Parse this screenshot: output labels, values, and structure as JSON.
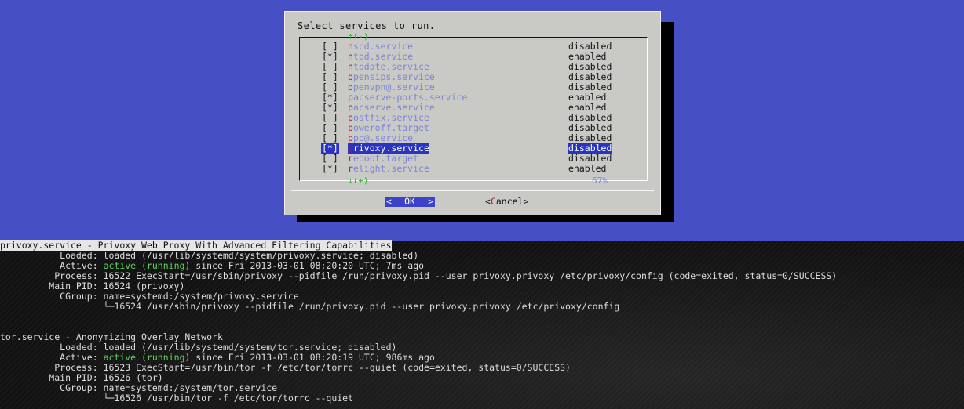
{
  "dialog": {
    "title": "Select services to run.",
    "scroll_top": "↑(-)",
    "scroll_bottom": "↓(+)",
    "scroll_percent": "67%",
    "ok_label": "OK",
    "ok_left": "<",
    "ok_right": ">",
    "cancel_open": "<",
    "cancel_hotkey": "C",
    "cancel_rest": "ancel>",
    "services": [
      {
        "checkbox": "[ ]",
        "hotkey": "n",
        "name": "scd.service",
        "state": "disabled",
        "selected": false
      },
      {
        "checkbox": "[*]",
        "hotkey": "n",
        "name": "tpd.service",
        "state": "enabled",
        "selected": false
      },
      {
        "checkbox": "[ ]",
        "hotkey": "n",
        "name": "tpdate.service",
        "state": "disabled",
        "selected": false
      },
      {
        "checkbox": "[ ]",
        "hotkey": "o",
        "name": "pensips.service",
        "state": "disabled",
        "selected": false
      },
      {
        "checkbox": "[ ]",
        "hotkey": "o",
        "name": "penvpn@.service",
        "state": "disabled",
        "selected": false
      },
      {
        "checkbox": "[*]",
        "hotkey": "p",
        "name": "acserve-ports.service",
        "state": "enabled",
        "selected": false
      },
      {
        "checkbox": "[*]",
        "hotkey": "p",
        "name": "acserve.service",
        "state": "enabled",
        "selected": false
      },
      {
        "checkbox": "[ ]",
        "hotkey": "p",
        "name": "ostfix.service",
        "state": "disabled",
        "selected": false
      },
      {
        "checkbox": "[ ]",
        "hotkey": "p",
        "name": "oweroff.target",
        "state": "disabled",
        "selected": false
      },
      {
        "checkbox": "[ ]",
        "hotkey": "p",
        "name": "pp@.service",
        "state": "disabled",
        "selected": false
      },
      {
        "checkbox": "[*]",
        "hotkey": "p",
        "name": "rivoxy.service",
        "state": "disabled",
        "selected": true
      },
      {
        "checkbox": "[ ]",
        "hotkey": "r",
        "name": "eboot.target",
        "state": "disabled",
        "selected": false
      },
      {
        "checkbox": "[*]",
        "hotkey": "r",
        "name": "elight.service",
        "state": "enabled",
        "selected": false
      }
    ]
  },
  "terminal": {
    "privoxy": {
      "header": "privoxy.service - Privoxy Web Proxy With Advanced Filtering Capabilities",
      "loaded": "           Loaded: loaded (/usr/lib/systemd/system/privoxy.service; disabled)",
      "active_prefix": "           Active: ",
      "active_status": "active (running)",
      "active_rest": " since Fri 2013-03-01 08:20:20 UTC; 7ms ago",
      "process": "          Process: 16522 ExecStart=/usr/sbin/privoxy --pidfile /run/privoxy.pid --user privoxy.privoxy /etc/privoxy/config (code=exited, status=0/SUCCESS)",
      "main_pid": "         Main PID: 16524 (privoxy)",
      "cgroup": "           CGroup: name=systemd:/system/privoxy.service",
      "cgroup_child": "                   └─16524 /usr/sbin/privoxy --pidfile /run/privoxy.pid --user privoxy.privoxy /etc/privoxy/config"
    },
    "tor": {
      "header": "tor.service - Anonymizing Overlay Network",
      "loaded": "           Loaded: loaded (/usr/lib/systemd/system/tor.service; disabled)",
      "active_prefix": "           Active: ",
      "active_status": "active (running)",
      "active_rest": " since Fri 2013-03-01 08:20:19 UTC; 986ms ago",
      "process": "          Process: 16523 ExecStart=/usr/bin/tor -f /etc/tor/torrc --quiet (code=exited, status=0/SUCCESS)",
      "main_pid": "         Main PID: 16526 (tor)",
      "cgroup": "           CGroup: name=systemd:/system/tor.service",
      "cgroup_child": "                   └─16526 /usr/bin/tor -f /etc/tor/torrc --quiet"
    }
  },
  "colors": {
    "dialog_backdrop": "#4650c4",
    "dialog_bg": "#c9c9c5",
    "service_text": "#7b84da",
    "hotkey": "#b0213b",
    "selection": "#2a34c0",
    "active_green": "#5ad35a"
  }
}
